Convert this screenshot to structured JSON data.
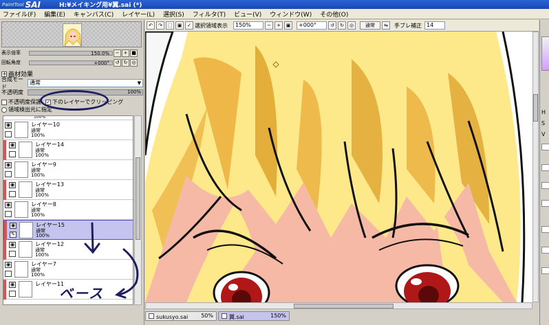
{
  "window": {
    "logo_small": "PaintTool",
    "logo": "SAI",
    "title": "H:¥メイキング用¥翼.sai (*)"
  },
  "menu": [
    "ファイル(F)",
    "編集(E)",
    "キャンバス(C)",
    "レイヤー(L)",
    "選択(S)",
    "フィルタ(T)",
    "ビュー(V)",
    "ウィンドウ(W)",
    "その他(O)"
  ],
  "navigator": {
    "zoom_label": "表示倍率",
    "zoom_value": "150.0%",
    "angle_label": "回転角度",
    "angle_value": "+000°"
  },
  "layer_panel": {
    "effects_label": "画材効果",
    "blend_label": "合成モード",
    "blend_value": "通常",
    "opacity_label": "不透明度",
    "opacity_value": "100%",
    "opacity_fraction": 1.0,
    "preserve_label": "不透明度保護",
    "clip_label": "下のレイヤーでクリッピング",
    "selection_source_label": "領域検出元に指定",
    "partial_top_opacity": "100%",
    "layers": [
      {
        "name": "レイヤー10",
        "mode": "通常",
        "opacity": "100%",
        "clip": false,
        "selected": false
      },
      {
        "name": "レイヤー14",
        "mode": "通常",
        "opacity": "100%",
        "clip": true,
        "selected": false
      },
      {
        "name": "レイヤー9",
        "mode": "通常",
        "opacity": "100%",
        "clip": false,
        "selected": false
      },
      {
        "name": "レイヤー13",
        "mode": "通常",
        "opacity": "100%",
        "clip": true,
        "selected": false
      },
      {
        "name": "レイヤー8",
        "mode": "通常",
        "opacity": "100%",
        "clip": false,
        "selected": false
      },
      {
        "name": "レイヤー15",
        "mode": "通常",
        "opacity": "100%",
        "clip": true,
        "selected": true
      },
      {
        "name": "レイヤー12",
        "mode": "通常",
        "opacity": "100%",
        "clip": true,
        "selected": false
      },
      {
        "name": "レイヤー7",
        "mode": "通常",
        "opacity": "100%",
        "clip": false,
        "selected": false
      },
      {
        "name": "レイヤー11",
        "mode": "",
        "opacity": "",
        "clip": true,
        "selected": false
      }
    ],
    "annotation_text": "ベース"
  },
  "canvas_toolbar": {
    "show_selection_label": "選択領域表示",
    "zoom": "150%",
    "angle": "+000°",
    "mode": "通常",
    "stabilizer_label": "手ブレ補正",
    "stabilizer_value": "14"
  },
  "tabs": [
    {
      "name": "sukusyo.sai",
      "zoom": "50%",
      "active": false
    },
    {
      "name": "翼.sai",
      "zoom": "150%",
      "active": true
    }
  ],
  "right_panel": {
    "labels": [
      "H",
      "S",
      "V"
    ]
  },
  "colors": {
    "hair": "#fde98a",
    "hair_shadow": "#d8941a",
    "skin": "#f6b9a6",
    "eye": "#b01818",
    "accent": "#5050c0"
  }
}
